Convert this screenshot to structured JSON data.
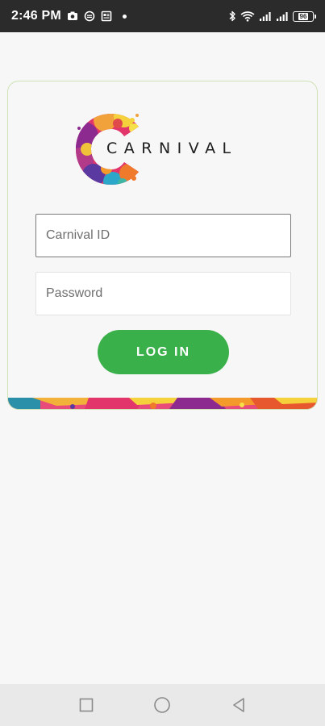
{
  "status_bar": {
    "time": "2:46 PM",
    "battery_level": "96",
    "left_icons": [
      "camera-icon",
      "chat-bubble-icon",
      "news-icon",
      "notification-dot-icon"
    ],
    "right_icons": [
      "bluetooth-icon",
      "wifi-icon",
      "signal-icon",
      "signal-icon",
      "battery-icon"
    ]
  },
  "login": {
    "logo_text": "CARNIVAL",
    "carnival_id_placeholder": "Carnival ID",
    "carnival_id_value": "",
    "password_placeholder": "Password",
    "password_value": "",
    "login_label": "LOG IN"
  },
  "nav_bar": {
    "items": [
      "recents-square-icon",
      "home-circle-icon",
      "back-triangle-icon"
    ]
  },
  "colors": {
    "status_bar_bg": "#2b2b2b",
    "page_bg": "#f7f7f7",
    "login_button": "#3ab04a",
    "card_border": "#cfe2b6",
    "nav_bar_bg": "#e9e9e9"
  }
}
